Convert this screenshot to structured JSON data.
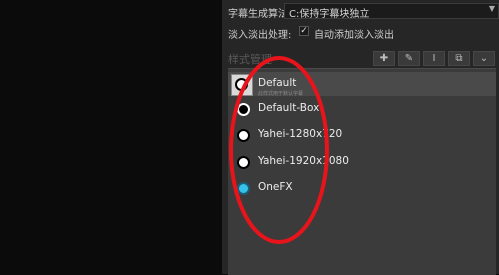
{
  "settings": {
    "algorithm_label": "字幕生成算法:",
    "algorithm_value": "C:保持字幕块独立",
    "fade_label": "淡入淡出处理:",
    "fade_checkbox_label": "自动添加淡入淡出",
    "fade_checked": true
  },
  "style_manager": {
    "title": "样式管理",
    "toolbar": [
      {
        "icon": "plus-icon",
        "glyph": "✚"
      },
      {
        "icon": "pencil-icon",
        "glyph": "✎"
      },
      {
        "icon": "text-cursor-icon",
        "glyph": "I"
      },
      {
        "icon": "copy-icon",
        "glyph": "⧉"
      },
      {
        "icon": "chevron-down-icon",
        "glyph": "⌄"
      }
    ],
    "styles": [
      {
        "name": "Default",
        "subtext": "此样式用于默认字幕",
        "dot": "white",
        "selected": true
      },
      {
        "name": "Default-Box",
        "dot": "black"
      },
      {
        "name": "Yahei-1280x720",
        "dot": "white"
      },
      {
        "name": "Yahei-1920x1080",
        "dot": "white"
      },
      {
        "name": "OneFX",
        "dot": "cyan"
      }
    ]
  },
  "colors": {
    "annotation": "#e8141b",
    "panel_bg": "#262626",
    "list_bg": "#3b3b3b"
  }
}
